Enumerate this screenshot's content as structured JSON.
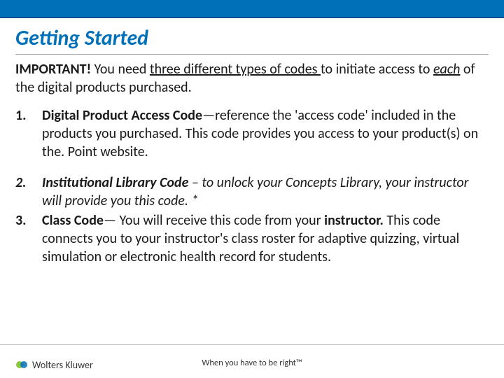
{
  "title": "Getting Started",
  "intro": {
    "important": "IMPORTANT!",
    "a": "  You need ",
    "three": "three different types of codes ",
    "b": " to initiate access to ",
    "each": "each",
    "c": " of the digital products purchased."
  },
  "items": [
    {
      "num": "1.",
      "title": "Digital Product Access Code",
      "sep": "—",
      "text": "reference the 'access code' included in the products you purchased.  This code provides you access to your product(s) on the. Point website."
    },
    {
      "num": "2.",
      "title": "Institutional Library Code",
      "sep": " – ",
      "text": "to unlock your Concepts Library, your instructor will provide you this code. *"
    },
    {
      "num": "3.",
      "title": "Class Code",
      "sep": "— ",
      "text_a": "You will receive this code from your ",
      "instr": "instructor.",
      "text_b": " This code connects you to your instructor's class roster for adaptive quizzing, virtual simulation or electronic health record for students."
    }
  ],
  "footer": {
    "brand": "Wolters Kluwer",
    "tagline": "When you have to be right™"
  }
}
